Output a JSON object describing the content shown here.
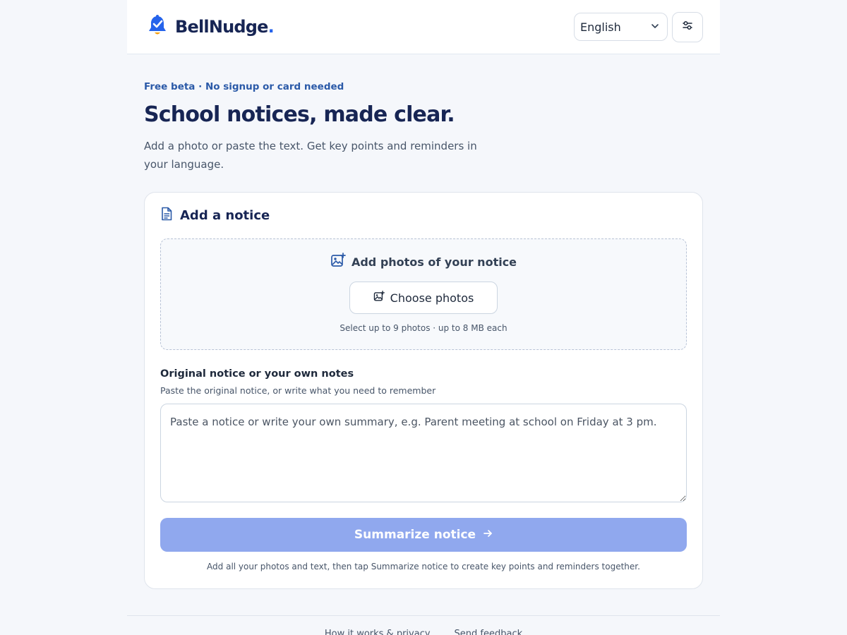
{
  "header": {
    "brand_name": "BellNudge",
    "brand_dot": ".",
    "language": "English"
  },
  "hero": {
    "eyebrow": "Free beta · No signup or card needed",
    "title": "School notices, made clear.",
    "lede": "Add a photo or paste the text. Get key points and reminders in your language."
  },
  "card": {
    "title": "Add a notice",
    "dropzone": {
      "title": "Add photos of your notice",
      "button_label": "Choose photos",
      "hint": "Select up to 9 photos · up to 8 MB each"
    },
    "notes": {
      "label": "Original notice or your own notes",
      "help": "Paste the original notice, or write what you need to remember",
      "placeholder": "Paste a notice or write your own summary, e.g. Parent meeting at school on Friday at 3 pm.",
      "value": ""
    },
    "submit_label": "Summarize notice",
    "submit_hint": "Add all your photos and text, then tap Summarize notice to create key points and reminders together."
  },
  "footer": {
    "links": [
      "How it works & privacy",
      "Send feedback"
    ]
  },
  "colors": {
    "brand_navy": "#172554",
    "accent_blue": "#2563eb",
    "submit_disabled": "#90a8ee",
    "page_bg": "#f5f7fb"
  },
  "icons": {
    "logo": "bell-check-icon",
    "language_chevron": "chevron-down-icon",
    "settings": "sliders-icon",
    "card": "document-icon",
    "dropzone": "image-plus-icon",
    "choose": "image-plus-icon",
    "submit": "arrow-right-icon"
  }
}
